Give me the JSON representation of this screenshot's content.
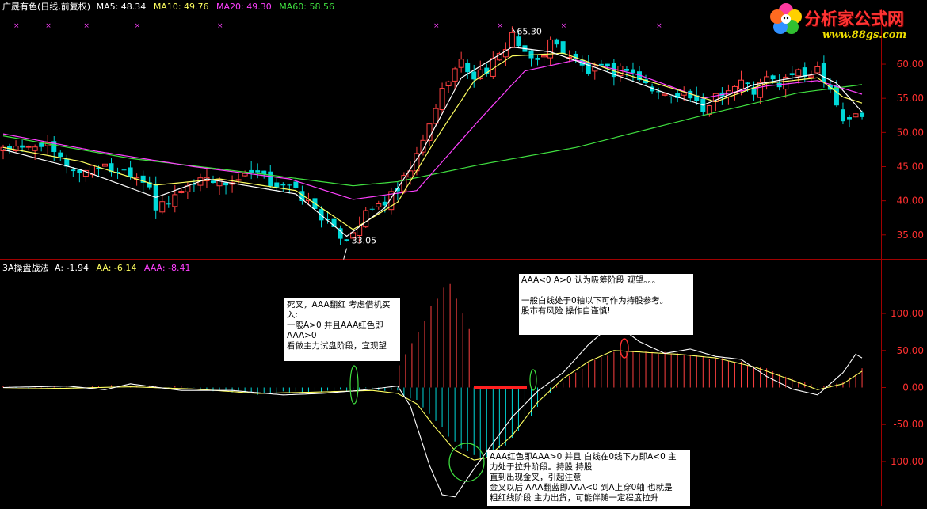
{
  "colors": {
    "background": "#000000",
    "frame": "#a00000",
    "up": "#ff4040",
    "down": "#00d8d8",
    "ma5": "#ffffff",
    "ma10": "#ffff60",
    "ma20": "#ff40ff",
    "ma60": "#40e040",
    "axis_text": "#ff3030",
    "aaa_line": "#ffff60",
    "a_line": "#ffffff"
  },
  "header": {
    "title": "广晟有色(日线,前复权)",
    "ma5": "MA5: 48.34",
    "ma10": "MA10: 49.76",
    "ma20": "MA20: 49.30",
    "ma60": "MA60: 58.56"
  },
  "indicator_header": {
    "name": "3A操盘战法",
    "a": "A: -1.94",
    "aa": "AA: -6.14",
    "aaa": "AAA: -8.41"
  },
  "logo": {
    "title": "分析家公式网",
    "url": "www.88gs.com"
  },
  "notes": {
    "left": [
      "死叉，AAA翻红 考虑借机买",
      "入:",
      " 一般A>0 并且AAA红色即",
      "AAA>0",
      "看做主力试盘阶段，宜观望"
    ],
    "top": [
      "AAA<0  A>0 认为吸筹阶段  观望。。。",
      "",
      "一般白线处于0轴以下可作为持股参考。",
      "股市有风险 操作自谨慎!"
    ],
    "bottom": [
      "AAA红色即AAA>0 并且 白线在0线下方即A<0 主",
      "力处于拉升阶段。持股  持股",
      "直到出现金叉，引起注意",
      "金叉以后 AAA翻蓝即AAA<0  到A上穿0轴 也就是",
      "粗红线阶段 主力出货，可能伴随一定程度拉升"
    ]
  },
  "chart_data": [
    {
      "type": "candlestick",
      "title": "广晟有色(日线,前复权)",
      "ylim": [
        31.5,
        68
      ],
      "yticks": [
        35.0,
        40.0,
        45.0,
        50.0,
        55.0,
        60.0
      ],
      "ytick_labels": [
        "35.00",
        "40.00",
        "45.00",
        "50.00",
        "55.00",
        "60.00"
      ],
      "annotations": [
        {
          "text": "65.30",
          "x_index": 80,
          "y": 65.3
        },
        {
          "text": "33.05",
          "x_index": 54,
          "y": 33.05
        }
      ],
      "anchors": [
        [
          0,
          48.0
        ],
        [
          3,
          47.3
        ],
        [
          6,
          48.5
        ],
        [
          9,
          46.0
        ],
        [
          12,
          44.0
        ],
        [
          14,
          45.3
        ],
        [
          17,
          44.6
        ],
        [
          20,
          44.2
        ],
        [
          23,
          42.5
        ],
        [
          24,
          38.8
        ],
        [
          26,
          39.5
        ],
        [
          28,
          41.8
        ],
        [
          30,
          42.5
        ],
        [
          32,
          43.8
        ],
        [
          34,
          42.6
        ],
        [
          36,
          42.8
        ],
        [
          38,
          43.4
        ],
        [
          40,
          43.8
        ],
        [
          42,
          42.6
        ],
        [
          44,
          42.4
        ],
        [
          46,
          41.2
        ],
        [
          48,
          39.8
        ],
        [
          50,
          37.8
        ],
        [
          52,
          35.4
        ],
        [
          54,
          34.6
        ],
        [
          56,
          36.8
        ],
        [
          58,
          38.8
        ],
        [
          60,
          39.8
        ],
        [
          62,
          41.4
        ],
        [
          64,
          44.5
        ],
        [
          66,
          48.5
        ],
        [
          68,
          53.8
        ],
        [
          70,
          58.2
        ],
        [
          72,
          60.2
        ],
        [
          74,
          58.2
        ],
        [
          76,
          59.2
        ],
        [
          78,
          61.0
        ],
        [
          80,
          64.5
        ],
        [
          82,
          61.0
        ],
        [
          84,
          60.5
        ],
        [
          86,
          63.2
        ],
        [
          88,
          62.0
        ],
        [
          90,
          60.4
        ],
        [
          92,
          58.8
        ],
        [
          94,
          59.2
        ],
        [
          96,
          58.8
        ],
        [
          98,
          59.6
        ],
        [
          100,
          57.8
        ],
        [
          102,
          56.2
        ],
        [
          104,
          55.4
        ],
        [
          106,
          55.8
        ],
        [
          108,
          55.2
        ],
        [
          110,
          52.6
        ],
        [
          112,
          55.8
        ],
        [
          114,
          56.2
        ],
        [
          116,
          57.4
        ],
        [
          118,
          56.0
        ],
        [
          120,
          57.8
        ],
        [
          122,
          57.0
        ],
        [
          124,
          58.6
        ],
        [
          126,
          58.2
        ],
        [
          128,
          59.6
        ],
        [
          130,
          56.6
        ],
        [
          132,
          51.8
        ],
        [
          134,
          52.4
        ],
        [
          135,
          52.2
        ]
      ],
      "ma_anchors": {
        "ma60": [
          [
            0,
            49.5
          ],
          [
            20,
            46.2
          ],
          [
            40,
            44.0
          ],
          [
            55,
            42.2
          ],
          [
            62,
            42.8
          ],
          [
            75,
            45.3
          ],
          [
            90,
            47.8
          ],
          [
            110,
            52.5
          ],
          [
            125,
            55.8
          ],
          [
            135,
            57.0
          ]
        ],
        "ma20": [
          [
            0,
            49.8
          ],
          [
            15,
            47.2
          ],
          [
            30,
            45.0
          ],
          [
            45,
            43.2
          ],
          [
            55,
            40.2
          ],
          [
            65,
            41.5
          ],
          [
            75,
            52.0
          ],
          [
            82,
            59.0
          ],
          [
            90,
            60.6
          ],
          [
            100,
            58.4
          ],
          [
            110,
            55.0
          ],
          [
            120,
            56.8
          ],
          [
            128,
            57.6
          ],
          [
            135,
            55.6
          ]
        ],
        "ma10": [
          [
            0,
            47.8
          ],
          [
            12,
            45.8
          ],
          [
            24,
            42.3
          ],
          [
            34,
            43.2
          ],
          [
            46,
            41.5
          ],
          [
            55,
            35.8
          ],
          [
            62,
            39.8
          ],
          [
            68,
            49.0
          ],
          [
            74,
            57.5
          ],
          [
            80,
            61.2
          ],
          [
            88,
            61.6
          ],
          [
            96,
            59.0
          ],
          [
            104,
            56.8
          ],
          [
            112,
            54.5
          ],
          [
            120,
            57.2
          ],
          [
            128,
            58.0
          ],
          [
            132,
            55.2
          ],
          [
            135,
            54.3
          ]
        ],
        "ma5": [
          [
            0,
            47.5
          ],
          [
            12,
            44.6
          ],
          [
            24,
            40.5
          ],
          [
            32,
            43.2
          ],
          [
            46,
            41.0
          ],
          [
            54,
            34.8
          ],
          [
            60,
            39.0
          ],
          [
            66,
            47.5
          ],
          [
            72,
            58.0
          ],
          [
            80,
            62.5
          ],
          [
            86,
            61.8
          ],
          [
            94,
            59.2
          ],
          [
            104,
            55.8
          ],
          [
            110,
            54.0
          ],
          [
            118,
            57.0
          ],
          [
            128,
            58.6
          ],
          [
            131,
            57.2
          ],
          [
            135,
            53.0
          ]
        ]
      }
    },
    {
      "type": "bar+line",
      "title": "3A操盘战法",
      "ylim": [
        -160,
        160
      ],
      "yticks": [
        -100,
        -50,
        0,
        50,
        100
      ],
      "ytick_labels": [
        "-100.00",
        "-50.00",
        "0.00",
        "50.00",
        "100.00"
      ],
      "series": [
        {
          "name": "A",
          "anchors": [
            [
              0,
              0
            ],
            [
              10,
              2
            ],
            [
              16,
              -3
            ],
            [
              20,
              5
            ],
            [
              28,
              -4
            ],
            [
              36,
              -4
            ],
            [
              44,
              -10
            ],
            [
              50,
              -8
            ],
            [
              56,
              -4
            ],
            [
              62,
              2
            ],
            [
              64,
              -25
            ],
            [
              67,
              -105
            ],
            [
              69,
              -145
            ],
            [
              71,
              -148
            ],
            [
              74,
              -110
            ],
            [
              77,
              -75
            ],
            [
              80,
              -40
            ],
            [
              84,
              -5
            ],
            [
              88,
              20
            ],
            [
              92,
              58
            ],
            [
              96,
              88
            ],
            [
              100,
              62
            ],
            [
              104,
              46
            ],
            [
              108,
              52
            ],
            [
              112,
              42
            ],
            [
              116,
              38
            ],
            [
              120,
              15
            ],
            [
              124,
              -2
            ],
            [
              128,
              -10
            ],
            [
              132,
              20
            ],
            [
              134,
              45
            ],
            [
              135,
              40
            ]
          ]
        },
        {
          "name": "AAA",
          "anchors": [
            [
              0,
              -2
            ],
            [
              10,
              -1
            ],
            [
              20,
              1
            ],
            [
              30,
              -2
            ],
            [
              40,
              -8
            ],
            [
              50,
              -6
            ],
            [
              58,
              -4
            ],
            [
              62,
              -8
            ],
            [
              65,
              -22
            ],
            [
              68,
              -55
            ],
            [
              71,
              -85
            ],
            [
              74,
              -98
            ],
            [
              76,
              -95
            ],
            [
              80,
              -65
            ],
            [
              84,
              -20
            ],
            [
              88,
              12
            ],
            [
              92,
              35
            ],
            [
              96,
              50
            ],
            [
              100,
              48
            ],
            [
              106,
              45
            ],
            [
              112,
              40
            ],
            [
              118,
              28
            ],
            [
              124,
              10
            ],
            [
              128,
              -3
            ],
            [
              132,
              5
            ],
            [
              135,
              22
            ]
          ]
        },
        {
          "name": "AA",
          "anchors": [
            [
              0,
              0
            ],
            [
              10,
              0
            ],
            [
              20,
              2
            ],
            [
              30,
              -1
            ],
            [
              40,
              -8
            ],
            [
              50,
              -5
            ],
            [
              58,
              -2
            ],
            [
              62,
              -6
            ],
            [
              65,
              -18
            ],
            [
              68,
              -45
            ],
            [
              71,
              -75
            ],
            [
              74,
              -92
            ],
            [
              76,
              -96
            ],
            [
              80,
              -70
            ],
            [
              84,
              -25
            ],
            [
              88,
              8
            ],
            [
              92,
              32
            ],
            [
              96,
              48
            ],
            [
              100,
              48
            ],
            [
              106,
              45
            ],
            [
              112,
              40
            ],
            [
              118,
              30
            ],
            [
              124,
              12
            ],
            [
              128,
              0
            ],
            [
              132,
              8
            ],
            [
              135,
              25
            ]
          ]
        }
      ]
    }
  ]
}
